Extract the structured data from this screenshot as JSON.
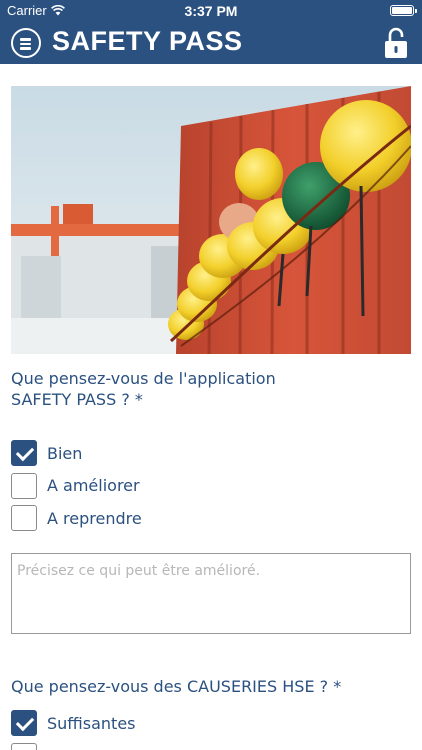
{
  "status_bar": {
    "carrier": "Carrier",
    "time": "3:37 PM"
  },
  "header": {
    "title": "SAFETY PASS",
    "menu_icon": "hamburger-menu-icon",
    "lock_icon": "unlock-icon",
    "color": "#2b5180"
  },
  "hero": {
    "subject": "hard-hats-hanging-on-red-container"
  },
  "survey": {
    "q1": {
      "label": "Que pensez-vous de l'application SAFETY PASS ? *",
      "options": [
        {
          "label": "Bien",
          "checked": true
        },
        {
          "label": "A améliorer",
          "checked": false
        },
        {
          "label": "A reprendre",
          "checked": false
        }
      ]
    },
    "comment": {
      "placeholder": "Précisez ce qui peut être amélioré.",
      "value": ""
    },
    "q2": {
      "label": "Que pensez-vous des CAUSERIES HSE ?  *",
      "options": [
        {
          "label": "Suffisantes",
          "checked": true
        },
        {
          "label": "",
          "checked": false
        }
      ]
    }
  },
  "colors": {
    "accent": "#2b5180",
    "text": "#2b5180"
  }
}
